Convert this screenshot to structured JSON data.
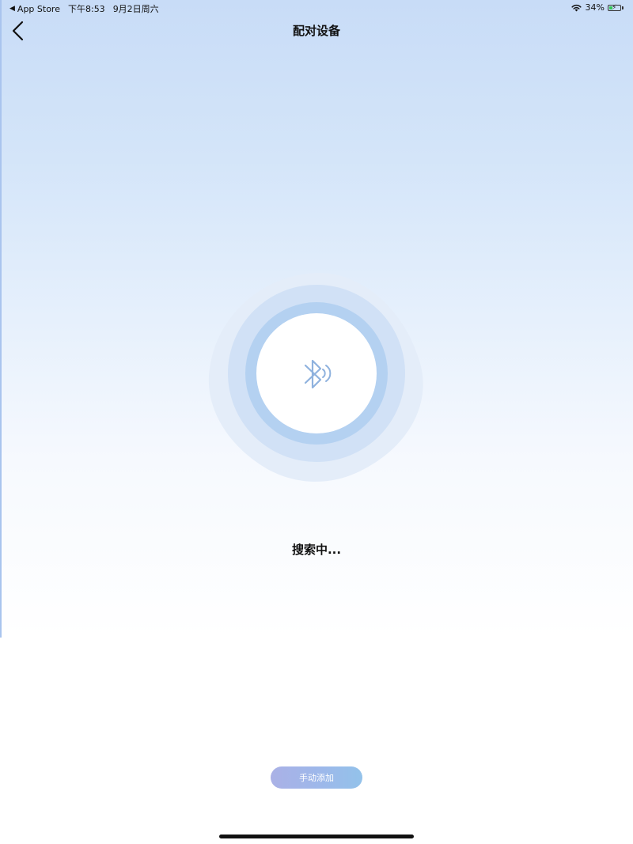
{
  "status_bar": {
    "back_app": "App Store",
    "time": "下午8:53",
    "date": "9月2日周六",
    "battery": "34%",
    "battery_level": 0.34,
    "icons": [
      "back-triangle-icon",
      "wifi-icon",
      "battery-icon",
      "charging-bolt-icon"
    ]
  },
  "nav": {
    "title": "配对设备",
    "back_icon": "chevron-left-icon"
  },
  "search": {
    "status": "搜索中...",
    "icon": "bluetooth-searching-icon"
  },
  "actions": {
    "manual_add": "手动添加"
  },
  "colors": {
    "gradient_top": "#c8dcf7",
    "ring_inner": "#b4d1f1",
    "bluetooth_icon": "#8fb2de",
    "button_start": "#aab1e6",
    "button_end": "#93c2ea",
    "battery_fill": "#34c759"
  }
}
